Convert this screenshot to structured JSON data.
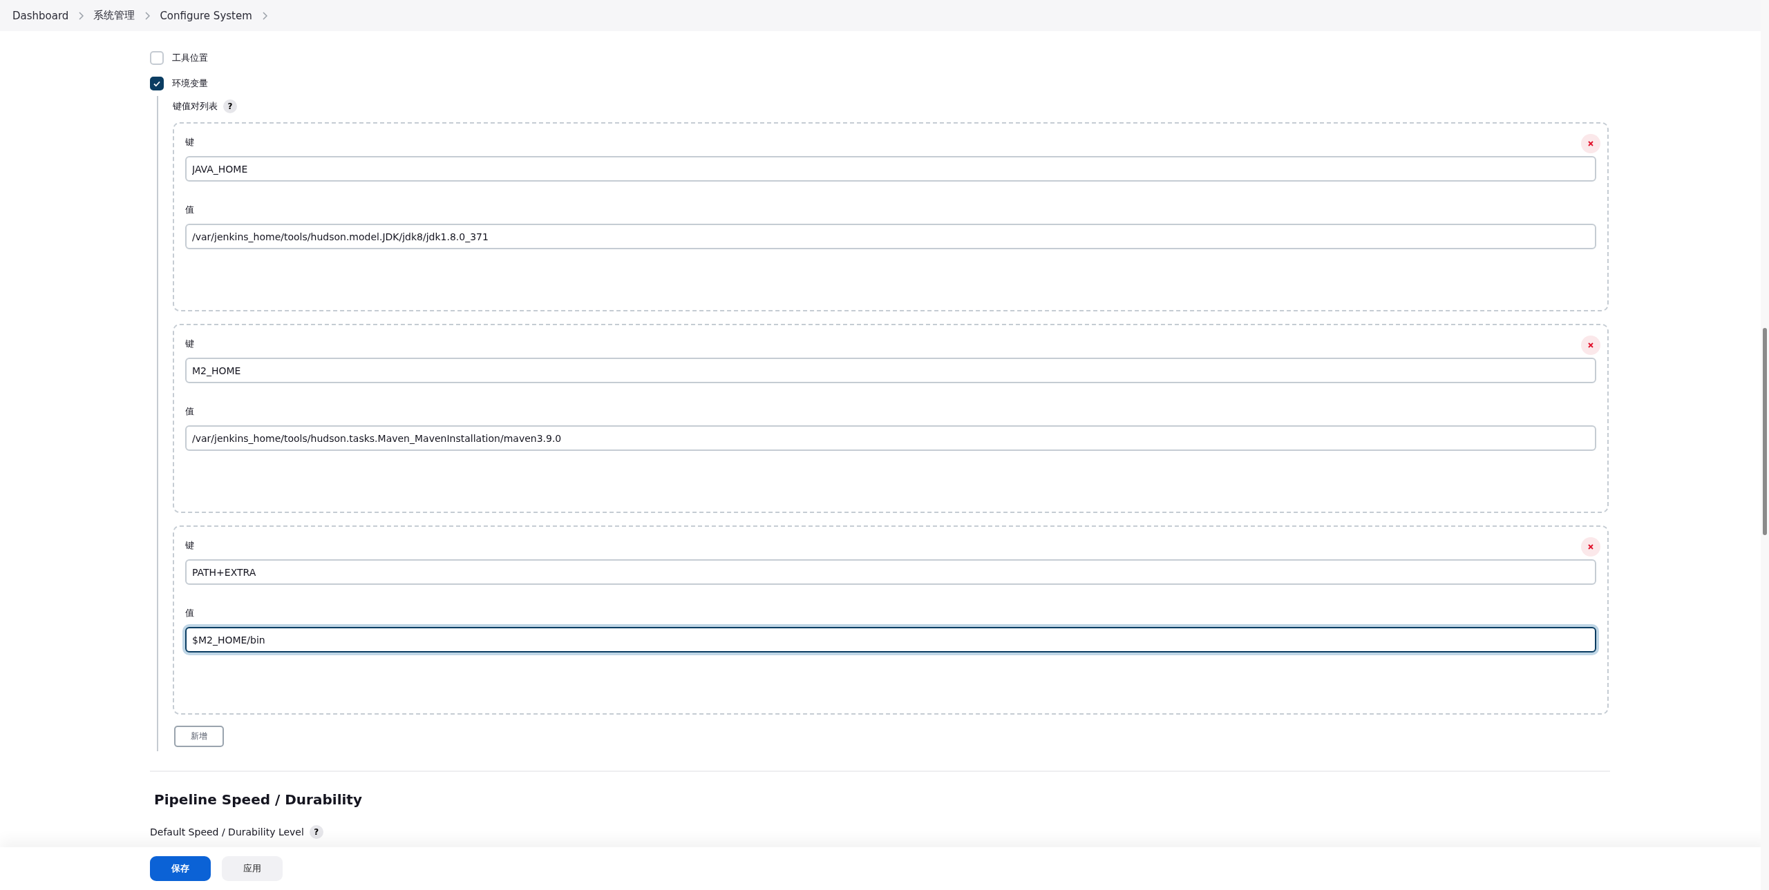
{
  "breadcrumbs": [
    {
      "label": "Dashboard"
    },
    {
      "label": "系统管理"
    },
    {
      "label": "Configure System"
    }
  ],
  "options": [
    {
      "label": "工具位置",
      "checked": false
    },
    {
      "label": "环境变量",
      "checked": true
    }
  ],
  "env_section": {
    "label": "键值对列表",
    "help": "?",
    "entries": [
      {
        "key_label": "键",
        "key": "JAVA_HOME",
        "value_label": "值",
        "value": "/var/jenkins_home/tools/hudson.model.JDK/jdk8/jdk1.8.0_371",
        "focused": false
      },
      {
        "key_label": "键",
        "key": "M2_HOME",
        "value_label": "值",
        "value": "/var/jenkins_home/tools/hudson.tasks.Maven_MavenInstallation/maven3.9.0",
        "focused": false
      },
      {
        "key_label": "键",
        "key": "PATH+EXTRA",
        "value_label": "值",
        "value": "$M2_HOME/bin",
        "focused": true
      }
    ],
    "add_button": "新增"
  },
  "section": {
    "title": "Pipeline Speed / Durability",
    "field_label": "Default Speed / Durability Level",
    "help": "?"
  },
  "footer": {
    "buttons": [
      {
        "label": "保存",
        "kind": "primary"
      },
      {
        "label": "应用",
        "kind": "secondary"
      }
    ]
  }
}
